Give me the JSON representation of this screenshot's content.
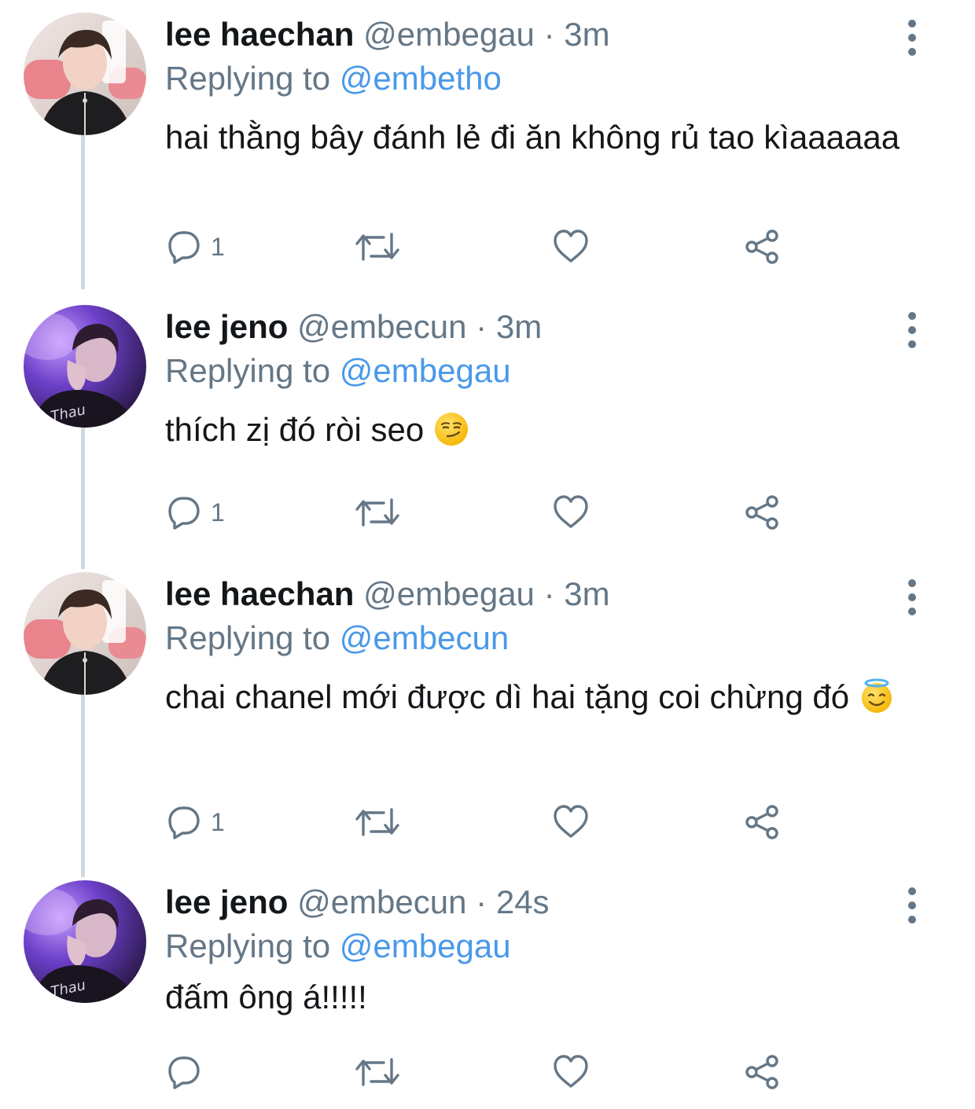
{
  "tweets": [
    {
      "name": "lee haechan",
      "handle": "@embegau",
      "separator": "·",
      "time": "3m",
      "replying_label": "Replying to",
      "replying_to": "@embetho",
      "text": "hai thằng bây đánh lẻ đi ăn không rủ tao kìaaaaaa",
      "reply_count": "1",
      "avatar": "avatar-haechan"
    },
    {
      "name": "lee jeno",
      "handle": "@embecun",
      "separator": "·",
      "time": "3m",
      "replying_label": "Replying to",
      "replying_to": "@embegau",
      "text": "thích zị đó ròi seo",
      "emoji": "smirk-emoji",
      "reply_count": "1",
      "avatar": "avatar-jeno"
    },
    {
      "name": "lee haechan",
      "handle": "@embegau",
      "separator": "·",
      "time": "3m",
      "replying_label": "Replying to",
      "replying_to": "@embecun",
      "text": "chai chanel mới được dì hai tặng coi chừng đó",
      "emoji": "halo-emoji",
      "reply_count": "1",
      "avatar": "avatar-haechan"
    },
    {
      "name": "lee jeno",
      "handle": "@embecun",
      "separator": "·",
      "time": "24s",
      "replying_label": "Replying to",
      "replying_to": "@embegau",
      "text": "đấm ông á!!!!!",
      "reply_count": "",
      "avatar": "avatar-jeno"
    }
  ],
  "colors": {
    "name": "#14171a",
    "meta": "#657786",
    "mention": "#4a99e9",
    "thread_line": "#cfd9de",
    "icon": "#657786"
  },
  "icons": [
    "reply-icon",
    "retweet-icon",
    "like-icon",
    "share-icon",
    "more-icon"
  ]
}
